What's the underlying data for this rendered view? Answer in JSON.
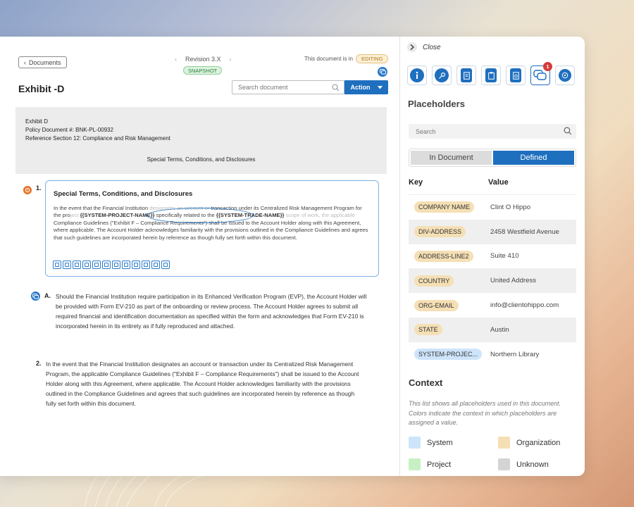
{
  "doc_panel": {
    "back_label": "Documents",
    "revision": "Revision 3.X",
    "snapshot_badge": "SNAPSHOT",
    "doc_state_label": "This document is in",
    "editing_badge": "EDITING",
    "title": "Exhibit -D",
    "search_placeholder": "Search document",
    "action_label": "Action",
    "header": {
      "line1": "Exhibit D",
      "line2": "Policy Document #: BNK-PL-00932",
      "line3": "Reference Section 12: Compliance and Risk Management",
      "center": "Special Terms, Conditions, and Disclosures"
    },
    "section1": {
      "number": "1.",
      "title": "Special Terms, Conditions, and Disclosures",
      "t1": "In the event that the Financial Institution ",
      "t1_faded": "designates an account or",
      "t2": " transaction under its Centralized Risk Management Program for the pro",
      "t2_faded": "ject ",
      "placeholder1": "{{SYSTEM-PROJECT-NAME}}",
      "t3": " specifically related to the ",
      "placeholder2": "{{SYSTEM-TRADE-NAME}}",
      "t4_faded": "  scope of work, the applicable ",
      "t5": "Compliance Guidelines (\"Exhibit F – Compliance Requirements\") shall be issued to the Account Holder along with this Agreement, where applicable. The Account Holder acknowledges familiarity with the provisions outlined in the Compliance Guidelines and agrees that such guidelines are incorporated herein by reference as though fully set forth within this document."
    },
    "sectionA": {
      "letter": "A.",
      "text": "Should the Financial Institution require participation in its Enhanced Verification Program (EVP), the Account Holder will be provided with Form EV-210 as part of the onboarding or review process. The Account Holder agrees to submit all required financial and identification documentation as specified within the form and acknowledges that Form EV-210 is incorporated herein in its entirety as if fully reproduced and attached."
    },
    "section2": {
      "number": "2.",
      "text": "In the event that the Financial Institution designates an account or transaction under its Centralized Risk Management Program, the applicable Compliance Guidelines (\"Exhibit F – Compliance Requirements\") shall be issued to the Account Holder along with this Agreement, where applicable. The Account Holder acknowledges familiarity with the provisions outlined in the Compliance Guidelines and agrees that such guidelines are incorporated herein by reference as though fully set forth within this document."
    }
  },
  "side_panel": {
    "close_label": "Close",
    "icons": [
      "info-icon",
      "key-icon",
      "document-icon",
      "clipboard-icon",
      "archive-icon",
      "comments-icon",
      "compass-icon"
    ],
    "notification_count": "1",
    "title": "Placeholders",
    "search_placeholder": "Search",
    "tabs": [
      "In Document",
      "Defined"
    ],
    "active_tab": "Defined",
    "col_key": "Key",
    "col_value": "Value",
    "rows": [
      {
        "key": "COMPANY NAME",
        "value": "Clint O Hippo",
        "color": "#f5dfb5"
      },
      {
        "key": "DIV-ADDRESS",
        "value": "2458 Westfield Avenue",
        "color": "#f5dfb5"
      },
      {
        "key": "ADDRESS-LINE2",
        "value": "Suite 410",
        "color": "#f5dfb5"
      },
      {
        "key": "COUNTRY",
        "value": "United Address",
        "color": "#f5dfb5"
      },
      {
        "key": "ORG-EMAIL",
        "value": "info@clientohippo.com",
        "color": "#f5dfb5"
      },
      {
        "key": "STATE",
        "value": "Austin",
        "color": "#f5dfb5"
      },
      {
        "key": "SYSTEM-PROJEC...",
        "value": "Northern Library",
        "color": "#cde4fb"
      }
    ],
    "context_title": "Context",
    "context_desc": "This list shows all placeholders used in this document. Colors indicate the context in which placeholders are assigned a value.",
    "legend": [
      {
        "label": "System",
        "color": "#cde4fb"
      },
      {
        "label": "Organization",
        "color": "#f5dfb5"
      },
      {
        "label": "Project",
        "color": "#c7f0c4"
      },
      {
        "label": "Unknown",
        "color": "#d4d4d4"
      }
    ],
    "accent": "#1f6fbf"
  }
}
